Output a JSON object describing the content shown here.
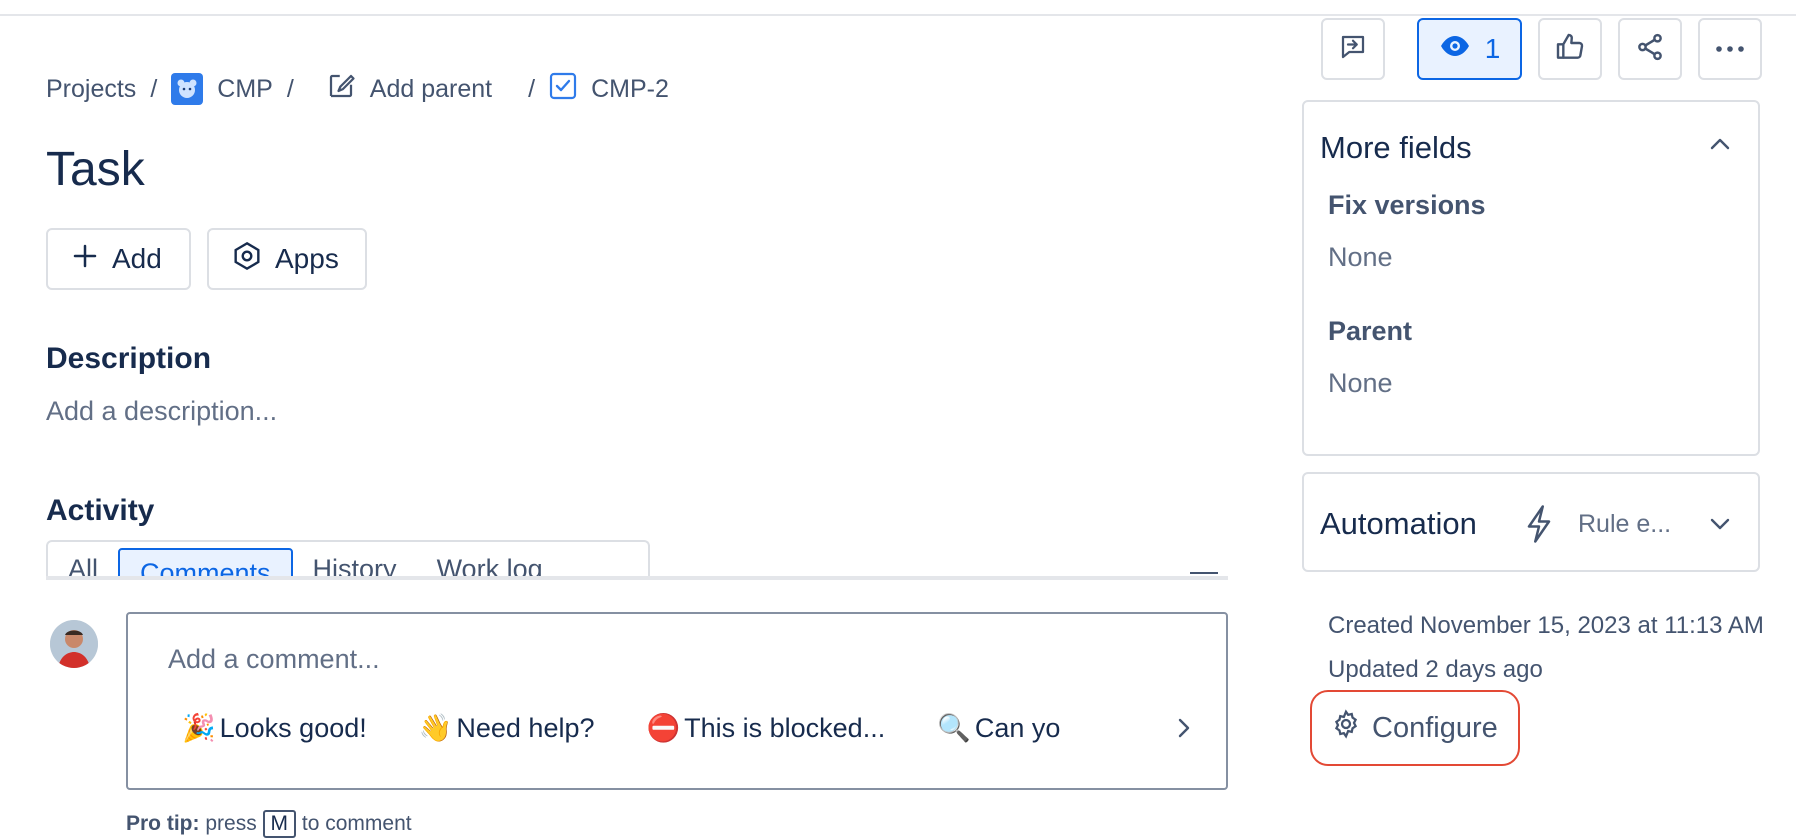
{
  "breadcrumb": {
    "projects": "Projects",
    "project": "CMP",
    "add_parent": "Add parent",
    "issue_key": "CMP-2",
    "separator": "/"
  },
  "issue": {
    "title": "Task"
  },
  "actions": {
    "add_label": "Add",
    "apps_label": "Apps"
  },
  "description": {
    "heading": "Description",
    "placeholder": "Add a description..."
  },
  "activity": {
    "heading": "Activity",
    "tabs": [
      "All",
      "Comments",
      "History",
      "Work log"
    ],
    "active_tab": "Comments"
  },
  "comment": {
    "placeholder": "Add a comment...",
    "quick_replies": [
      {
        "emoji": "🎉",
        "label": "Looks good!"
      },
      {
        "emoji": "👋",
        "label": "Need help?"
      },
      {
        "emoji": "⛔",
        "label": "This is blocked..."
      },
      {
        "emoji": "🔍",
        "label": "Can yo"
      }
    ],
    "protip_prefix": "Pro tip:",
    "protip_press": "press",
    "protip_key": "M",
    "protip_suffix": "to comment"
  },
  "toolbar": {
    "watch_count": "1"
  },
  "more_fields": {
    "heading": "More fields",
    "fix_versions_label": "Fix versions",
    "fix_versions_value": "None",
    "parent_label": "Parent",
    "parent_value": "None"
  },
  "automation": {
    "heading": "Automation",
    "rule_text": "Rule e..."
  },
  "meta": {
    "created": "Created November 15, 2023 at 11:13 AM",
    "updated": "Updated 2 days ago"
  },
  "configure": {
    "label": "Configure"
  },
  "colors": {
    "accent": "#0C66E4",
    "highlight": "#E34935",
    "text": "#172B4D"
  }
}
